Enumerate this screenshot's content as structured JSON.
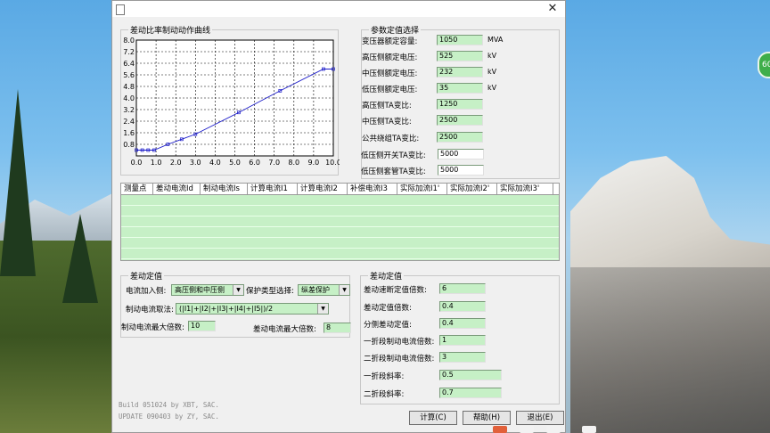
{
  "desktop": {
    "badge_text": "60"
  },
  "window": {
    "title": "",
    "close_glyph": "✕"
  },
  "chart_group": {
    "title": "差动比率制动动作曲线"
  },
  "chart_data": {
    "type": "line",
    "title": "差动比率制动动作曲线",
    "xlabel": "",
    "ylabel": "",
    "xlim": [
      0,
      10
    ],
    "ylim": [
      0,
      8
    ],
    "x_ticks": [
      "0.0",
      "1.0",
      "2.0",
      "3.0",
      "4.0",
      "5.0",
      "6.0",
      "7.0",
      "8.0",
      "9.0",
      "10.0"
    ],
    "y_ticks": [
      "0.8",
      "1.6",
      "2.4",
      "3.2",
      "4.0",
      "4.8",
      "5.6",
      "6.4",
      "7.2",
      "8.0"
    ],
    "grid": true,
    "series": [
      {
        "x": [
          0.0,
          0.3,
          0.6,
          0.9,
          1.6,
          2.3,
          3.0,
          5.2,
          7.3,
          9.5,
          10.0
        ],
        "y": [
          0.4,
          0.4,
          0.4,
          0.4,
          0.8,
          1.15,
          1.5,
          3.0,
          4.5,
          6.0,
          6.0
        ]
      }
    ]
  },
  "params": {
    "title": "参数定值选择",
    "rows": [
      {
        "label": "变压器额定容量:",
        "value": "1050",
        "unit": "MVA"
      },
      {
        "label": "高压侧额定电压:",
        "value": "525",
        "unit": "kV"
      },
      {
        "label": "中压侧额定电压:",
        "value": "232",
        "unit": "kV"
      },
      {
        "label": "低压侧额定电压:",
        "value": "35",
        "unit": "kV"
      },
      {
        "label": "高压侧TA变比:",
        "value": "1250",
        "unit": ""
      },
      {
        "label": "中压侧TA变比:",
        "value": "2500",
        "unit": ""
      },
      {
        "label": "公共绕组TA变比:",
        "value": "2500",
        "unit": ""
      },
      {
        "label": "低压侧开关TA变比:",
        "value": "5000",
        "unit": ""
      },
      {
        "label": "低压侧套管TA变比:",
        "value": "5000",
        "unit": ""
      }
    ]
  },
  "table": {
    "headers": [
      "测量点",
      "差动电流Id",
      "制动电流Is",
      "计算电流I1",
      "计算电流I2",
      "补偿电流I3",
      "实际加流I1'",
      "实际加流I2'",
      "实际加流I3'"
    ]
  },
  "diff": {
    "title": "差动定值",
    "current_side_label": "电流加入侧:",
    "current_side_value": "高压侧和中压侧",
    "protection_label": "保护类型选择:",
    "protection_value": "纵差保护",
    "brake_method_label": "制动电流取法:",
    "brake_method_value": "(|I1|+|I2|+|I3|+|I4|+|I5|)/2",
    "brake_max_label": "制动电流最大倍数:",
    "brake_max_value": "10",
    "diff_max_label": "差动电流最大倍数:",
    "diff_max_value": "8"
  },
  "settings": {
    "title": "差动定值",
    "rows": [
      {
        "label": "差动速断定值倍数:",
        "value": "6"
      },
      {
        "label": "差动定值倍数:",
        "value": "0.4"
      },
      {
        "label": "分侧差动定值:",
        "value": "0.4"
      },
      {
        "label": "一折段制动电流倍数:",
        "value": "1"
      },
      {
        "label": "二折段制动电流倍数:",
        "value": "3"
      },
      {
        "label": "一折段斜率:",
        "value": "0.5"
      },
      {
        "label": "二折段斜率:",
        "value": "0.7"
      }
    ]
  },
  "build": {
    "line1": "Build 051024 by XBT, SAC.",
    "line2": "UPDATE 090403 by ZY, SAC."
  },
  "buttons": {
    "calc": "计算(C)",
    "help": "帮助(H)",
    "exit": "退出(E)"
  },
  "colors": {
    "field_bg": "#c6f0c6",
    "curve": "#1a1ac8"
  }
}
